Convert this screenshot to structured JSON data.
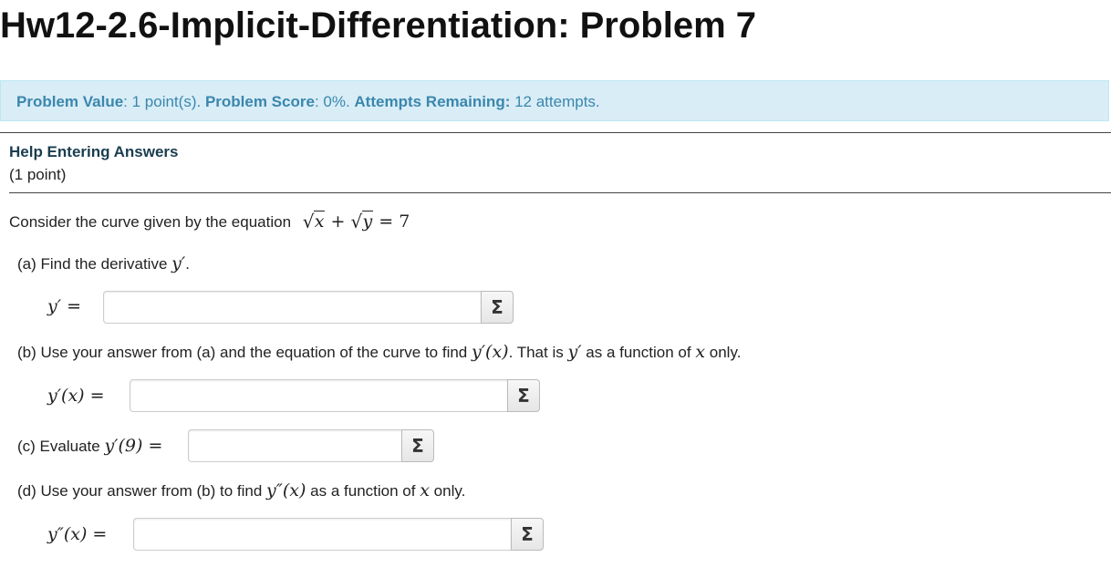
{
  "page": {
    "title": "Hw12-2.6-Implicit-Differentiation: Problem 7"
  },
  "info": {
    "value_label": "Problem Value",
    "value_text": ": 1 point(s). ",
    "score_label": "Problem Score",
    "score_text": ": 0%. ",
    "attempts_label": "Attempts Remaining:",
    "attempts_text": " 12 attempts."
  },
  "help": {
    "link": "Help Entering Answers",
    "points": "(1 point)"
  },
  "problem": {
    "intro": "Consider the curve given by the equation",
    "eq_x": "x",
    "eq_plus": "+",
    "eq_y": "y",
    "eq_rhs": "= 7",
    "a_text": "(a) Find the derivative",
    "a_math": "y′",
    "a_end": ".",
    "a_label": "y′ =",
    "b_text": "(b) Use your answer from (a) and the equation of the curve to find",
    "b_math1": "y′(x)",
    "b_mid": ". That is",
    "b_math2": "y′",
    "b_mid2": "as a function of",
    "b_math3": "x",
    "b_end": "only.",
    "b_label": "y′(x) =",
    "c_text": "(c) Evaluate",
    "c_math": "y′(9) =",
    "d_text": "(d) Use your answer from (b) to find",
    "d_math1": "y″(x)",
    "d_mid": "as a function of",
    "d_math2": "x",
    "d_end": "only.",
    "d_label": "y″(x) ="
  },
  "answers": {
    "a_value": "",
    "b_value": "",
    "c_value": "",
    "d_value": "",
    "equation_button_glyph": "Σ",
    "equation_button_icon": "sigma-icon"
  }
}
